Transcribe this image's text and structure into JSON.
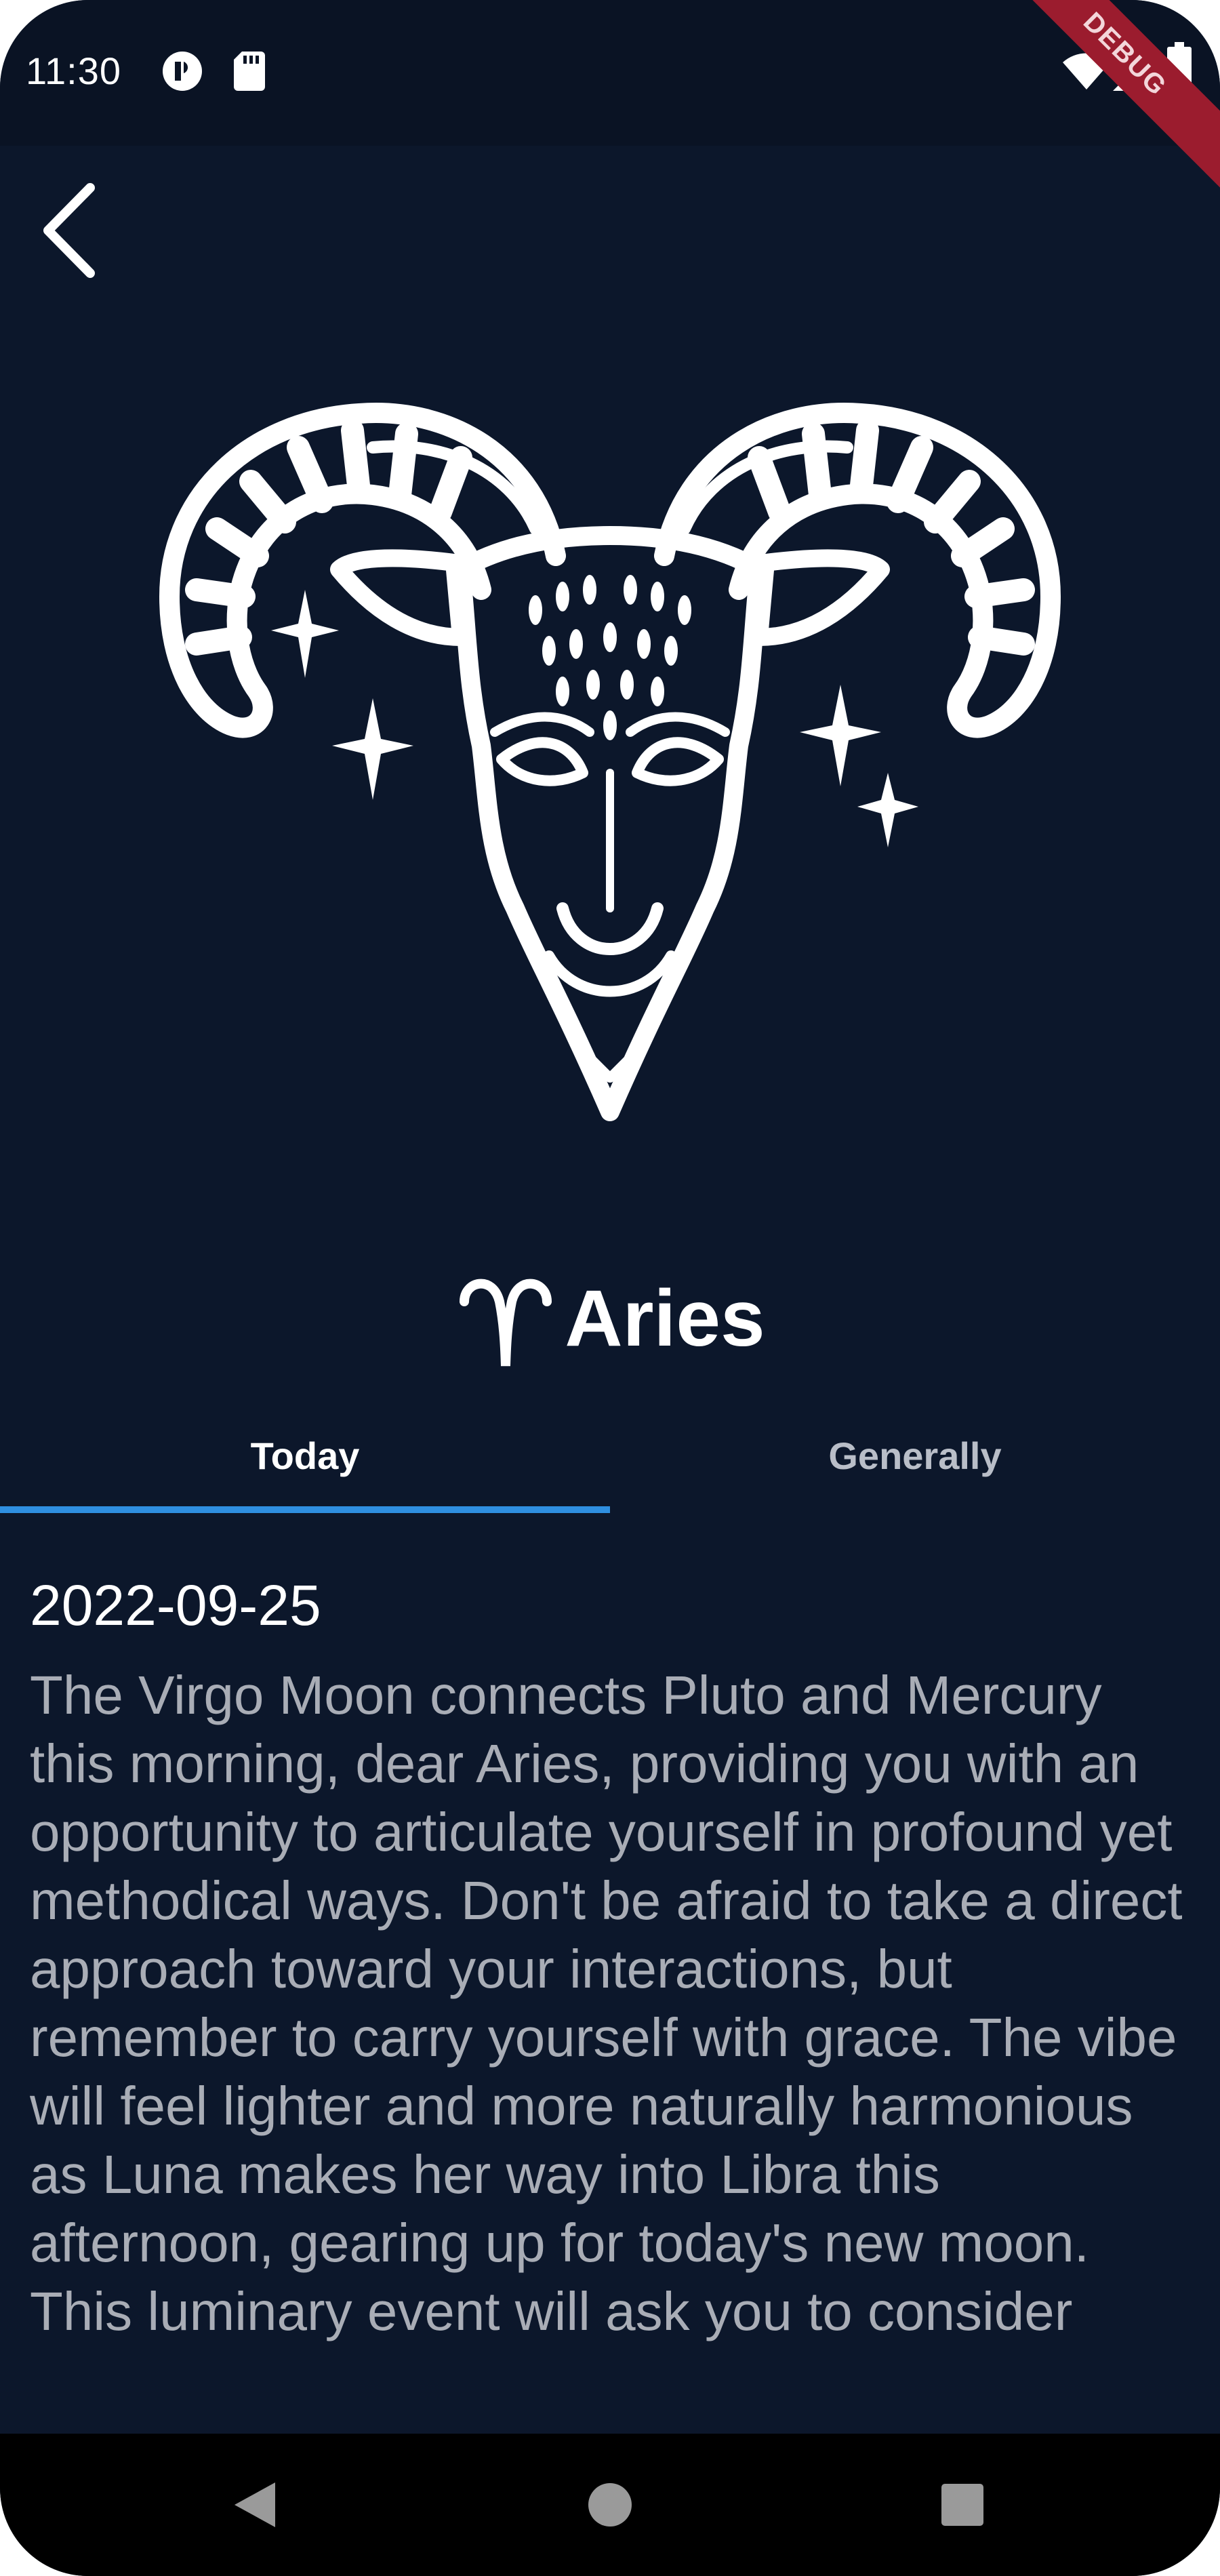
{
  "status_bar": {
    "time": "11:30",
    "icons": [
      "media-icon",
      "sd-card-icon",
      "wifi-icon",
      "signal-icon",
      "battery-icon"
    ],
    "debug_label": "DEBUG"
  },
  "header": {
    "back_icon": "chevron-left-icon"
  },
  "sign": {
    "image_icon": "aries-ram-head-illustration",
    "symbol_icon": "aries-symbol-icon",
    "name": "Aries"
  },
  "tabs": [
    {
      "label": "Today",
      "selected": true
    },
    {
      "label": "Generally",
      "selected": false
    }
  ],
  "content": {
    "date": "2022-09-25",
    "text": "The Virgo Moon connects Pluto and Mercury this morning, dear Aries, providing you with an opportunity to articulate yourself in profound yet methodical ways. Don't be afraid to take a direct approach toward your interactions, but remember to carry yourself with grace. The vibe will feel lighter and more naturally harmonious as Luna makes her way into Libra this afternoon, gearing up for today's new moon. This luminary event will ask you to consider"
  },
  "nav_bar": {
    "buttons": [
      "back-triangle-icon",
      "home-circle-icon",
      "recents-square-icon"
    ]
  },
  "colors": {
    "background": "#0c172b",
    "status_bar": "#0a1324",
    "accent": "#2f8fe0",
    "body_text": "#a9adb6",
    "debug_banner": "#9b1c2e"
  }
}
